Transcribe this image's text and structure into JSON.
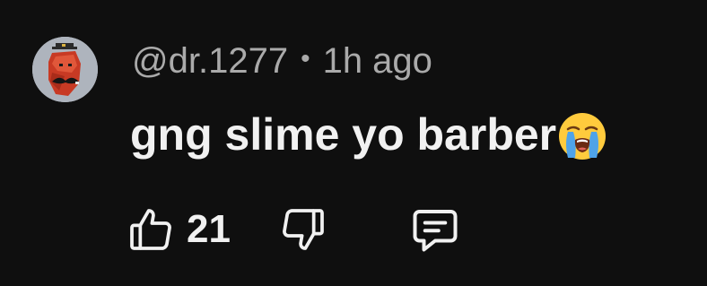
{
  "comment": {
    "handle": "@dr.1277",
    "separator": "•",
    "time": "1h ago",
    "text": "gng slime yo barber",
    "emoji": "loudly-crying-face-emoji",
    "like_count": "21"
  },
  "icons": {
    "like": "thumbs-up-icon",
    "dislike": "thumbs-down-icon",
    "reply": "comment-icon"
  },
  "colors": {
    "background": "#0f0f0f",
    "primary_text": "#f1f1f1",
    "secondary_text": "#aaaaaa"
  }
}
